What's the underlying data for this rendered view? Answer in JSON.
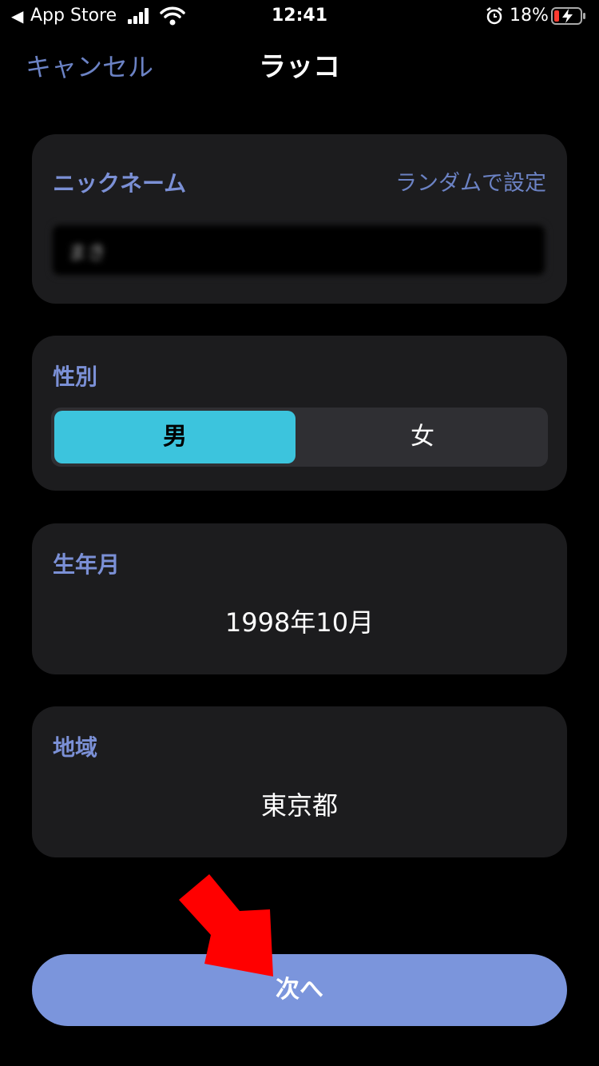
{
  "status_bar": {
    "back_app": "App Store",
    "time": "12:41",
    "battery_percent": "18%"
  },
  "nav": {
    "cancel_label": "キャンセル",
    "title": "ラッコ"
  },
  "nickname": {
    "label": "ニックネーム",
    "random_label": "ランダムで設定",
    "value": "まき"
  },
  "gender": {
    "label": "性別",
    "options": [
      "男",
      "女"
    ],
    "selected": "男"
  },
  "birth": {
    "label": "生年月",
    "value": "1998年10月"
  },
  "region": {
    "label": "地域",
    "value": "東京都"
  },
  "next_label": "次へ",
  "colors": {
    "accent_cyan": "#3cc4dd",
    "link_blue": "#6b82c4",
    "button_blue": "#7b95dc",
    "annotation_red": "#ff0000"
  },
  "icons": [
    "back-arrow-icon",
    "signal-icon",
    "wifi-icon",
    "alarm-icon",
    "battery-charging-icon",
    "annotation-arrow-icon"
  ]
}
